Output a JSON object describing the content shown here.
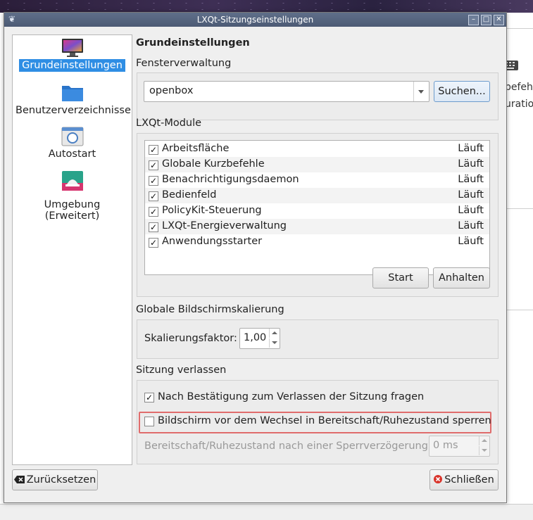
{
  "window": {
    "title": "LXQt-Sitzungseinstellungen",
    "app_icon": "lxqt-icon"
  },
  "sidebar": {
    "items": [
      {
        "label": "Grundeinstellungen",
        "icon": "monitor-icon",
        "active": true
      },
      {
        "label": "Benutzerverzeichnisse",
        "icon": "folder-icon",
        "active": false
      },
      {
        "label": "Autostart",
        "icon": "autostart-icon",
        "active": false
      },
      {
        "label": "Umgebung (Erweitert)",
        "icon": "environment-icon",
        "active": false
      }
    ]
  },
  "main": {
    "heading": "Grundeinstellungen",
    "window_manager": {
      "section_title": "Fensterverwaltung",
      "value": "openbox",
      "search_button": "Suchen..."
    },
    "modules": {
      "section_title": "LXQt-Module",
      "items": [
        {
          "name": "Arbeitsfläche",
          "status": "Läuft",
          "checked": true
        },
        {
          "name": "Globale Kurzbefehle",
          "status": "Läuft",
          "checked": true
        },
        {
          "name": "Benachrichtigungsdaemon",
          "status": "Läuft",
          "checked": true
        },
        {
          "name": "Bedienfeld",
          "status": "Läuft",
          "checked": true
        },
        {
          "name": "PolicyKit-Steuerung",
          "status": "Läuft",
          "checked": true
        },
        {
          "name": "LXQt-Energieverwaltung",
          "status": "Läuft",
          "checked": true
        },
        {
          "name": "Anwendungsstarter",
          "status": "Läuft",
          "checked": true
        }
      ],
      "start_button": "Start",
      "stop_button": "Anhalten"
    },
    "scaling": {
      "section_title": "Globale Bildschirmskalierung",
      "label": "Skalierungsfaktor:",
      "value": "1,00"
    },
    "leave": {
      "section_title": "Sitzung verlassen",
      "confirm_label": "Nach Bestätigung zum Verlassen der Sitzung fragen",
      "confirm_checked": true,
      "lock_label": "Bildschirm vor dem Wechsel in Bereitschaft/Ruhezustand sperren",
      "lock_checked": false,
      "delay_label": "Bereitschaft/Ruhezustand nach einer Sperrverzögerung:",
      "delay_value": "0 ms"
    }
  },
  "footer": {
    "reset_button": "Zurücksetzen",
    "close_button": "Schließen"
  },
  "background": {
    "text1": "befehle",
    "text2": "uration",
    "colors": {
      "accent": "#2f8ee4",
      "highlight_border": "#e06c6c"
    }
  }
}
